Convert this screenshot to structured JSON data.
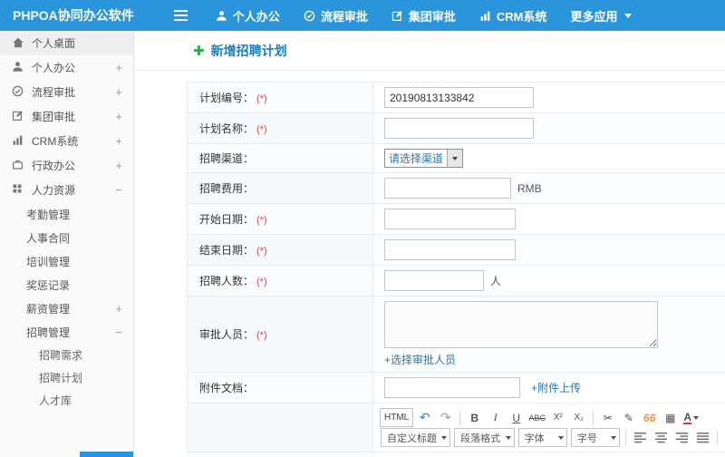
{
  "topbar": {
    "brand": "PHPOA协同办公软件",
    "nav": [
      {
        "label": "个人办公"
      },
      {
        "label": "流程审批"
      },
      {
        "label": "集团审批"
      },
      {
        "label": "CRM系统"
      },
      {
        "label": "更多应用"
      }
    ]
  },
  "sidebar": {
    "items": [
      {
        "label": "个人桌面"
      },
      {
        "label": "个人办公",
        "toggle": "+"
      },
      {
        "label": "流程审批",
        "toggle": "+"
      },
      {
        "label": "集团审批",
        "toggle": "+"
      },
      {
        "label": "CRM系统",
        "toggle": "+"
      },
      {
        "label": "行政办公",
        "toggle": "+"
      },
      {
        "label": "人力资源",
        "toggle": "−"
      }
    ],
    "hr_children": [
      {
        "label": "考勤管理"
      },
      {
        "label": "人事合同"
      },
      {
        "label": "培训管理"
      },
      {
        "label": "奖惩记录"
      },
      {
        "label": "薪资管理",
        "toggle": "+"
      },
      {
        "label": "招聘管理",
        "toggle": "−"
      }
    ],
    "recruit_children": [
      {
        "label": "招聘需求"
      },
      {
        "label": "招聘计划"
      },
      {
        "label": "人才库"
      }
    ]
  },
  "page": {
    "plus_icon": "✚",
    "title": "新增招聘计划"
  },
  "form": {
    "required_mark": "(*)",
    "rows": [
      {
        "label": "计划编号：",
        "value": "20190813133842"
      },
      {
        "label": "计划名称：",
        "value": ""
      },
      {
        "label": "招聘渠道：",
        "select_value": "请选择渠道"
      },
      {
        "label": "招聘费用：",
        "value": "",
        "suffix": "RMB"
      },
      {
        "label": "开始日期：",
        "value": ""
      },
      {
        "label": "结束日期：",
        "value": ""
      },
      {
        "label": "招聘人数：",
        "value": "",
        "suffix": "人"
      },
      {
        "label": "审批人员：",
        "link": "+选择审批人员"
      },
      {
        "label": "附件文档：",
        "value": "",
        "link": "+附件上传"
      }
    ]
  },
  "editor": {
    "html_btn": "HTML",
    "row1": [
      "↶",
      "↷",
      "B",
      "I",
      "U",
      "ABC",
      "X²",
      "X₂",
      "✂",
      "✎",
      "66",
      "▦",
      "A"
    ],
    "selects": [
      "自定义标题",
      "段落格式",
      "字体",
      "字号"
    ]
  }
}
